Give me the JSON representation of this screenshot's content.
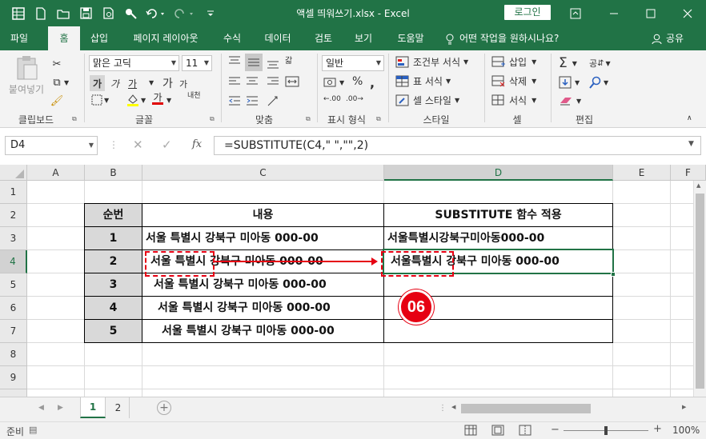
{
  "titlebar": {
    "doc_title": "액셀 띄워쓰기.xlsx  -  Excel",
    "login_label": "로그인",
    "qat_icons": [
      "excel-icon",
      "new-file-icon",
      "open-folder-icon",
      "save-icon",
      "print-preview-icon",
      "touch-mode-icon",
      "undo-icon",
      "redo-icon",
      "customize-icon"
    ]
  },
  "tabs": [
    {
      "label": "파일"
    },
    {
      "label": "홈"
    },
    {
      "label": "삽입"
    },
    {
      "label": "페이지 레이아웃"
    },
    {
      "label": "수식"
    },
    {
      "label": "데이터"
    },
    {
      "label": "검토"
    },
    {
      "label": "보기"
    },
    {
      "label": "도움말"
    }
  ],
  "tell_me": "어떤 작업을 원하시나요?",
  "share_label": "공유",
  "ribbon": {
    "paste_label": "붙여넣기",
    "clipboard_label": "클립보드",
    "font_name": "맑은 고딕",
    "font_size": "11",
    "font_group_label": "글꼴",
    "bold": "가",
    "italic": "가",
    "underline": "가",
    "grow": "가",
    "shrink": "가",
    "phonetic": "내천",
    "font_color_glyph": "가",
    "align_group_label": "맞춤",
    "wrap_glyph": "갋",
    "number_format": "일반",
    "number_group_label": "표시 형식",
    "cond_format": "조건부 서식",
    "table_format": "표 서식",
    "cell_style": "셀 스타일",
    "style_group_label": "스타일",
    "insert": "삽입",
    "delete": "삭제",
    "format": "서식",
    "cells_group_label": "셀",
    "sort_glyph": "공",
    "edit_group_label": "편집"
  },
  "formula_bar": {
    "name_box": "D4",
    "fx": "fx",
    "formula": "=SUBSTITUTE(C4,\" \",\"\",2)"
  },
  "columns": [
    "A",
    "B",
    "C",
    "D",
    "E",
    "F"
  ],
  "rows": [
    "1",
    "2",
    "3",
    "4",
    "5",
    "6",
    "7",
    "8",
    "9"
  ],
  "table": {
    "headers": [
      "순번",
      "내용",
      "SUBSTITUTE 함수 적용"
    ],
    "rows": [
      {
        "num": "1",
        "content": "서울 특별시 강북구 미아동 000-00",
        "result": "서울특별시강북구미아동000-00"
      },
      {
        "num": "2",
        "content": "서울 특별시 강북구 미아동 000-00",
        "result": "서울특별시 강북구 미아동 000-00"
      },
      {
        "num": "3",
        "content": "서울 특별시 강북구 미아동 000-00",
        "result": ""
      },
      {
        "num": "4",
        "content": "서울 특별시 강북구 미아동 000-00",
        "result": ""
      },
      {
        "num": "5",
        "content": "서울 특별시 강북구 미아동 000-00",
        "result": ""
      }
    ]
  },
  "annotation": {
    "step_badge": "06",
    "accent": "#e60012"
  },
  "sheets": [
    "1",
    "2"
  ],
  "status": {
    "ready": "준비",
    "zoom": "100%"
  },
  "colors": {
    "excel_green": "#217346",
    "header_fill": "#d9d9d9",
    "selection": "#217346"
  }
}
